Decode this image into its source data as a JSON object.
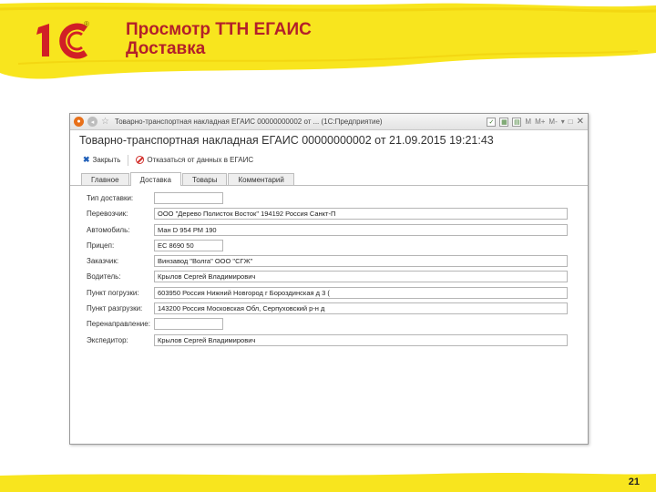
{
  "slide": {
    "logo_text": "1С",
    "logo_mark": "®",
    "title_line1": "Просмотр ТТН ЕГАИС",
    "title_line2": "Доставка",
    "page_number": "21",
    "accent_color": "#f8e51e",
    "title_color": "#b3202a"
  },
  "window": {
    "title": "Товарно-транспортная накладная ЕГАИС 00000000002 от ... (1С:Предприятие)",
    "controls": {
      "m": "M",
      "m_plus": "M+",
      "m_minus": "M-",
      "menu": "▾",
      "restore": "□",
      "close": "✕"
    },
    "doc_title": "Товарно-транспортная накладная ЕГАИС 00000000002 от 21.09.2015 19:21:43",
    "toolbar": {
      "close_label": "Закрыть",
      "reject_label": "Отказаться от данных в ЕГАИС"
    },
    "tabs": [
      {
        "label": "Главное",
        "active": false
      },
      {
        "label": "Доставка",
        "active": true
      },
      {
        "label": "Товары",
        "active": false
      },
      {
        "label": "Комментарий",
        "active": false
      }
    ],
    "fields": [
      {
        "label": "Тип доставки:",
        "value": "",
        "width": "short"
      },
      {
        "label": "Перевозчик:",
        "value": "ООО \"Дерево Полисток Восток\" 194192 Россия Санкт-П",
        "width": "long"
      },
      {
        "label": "Автомобиль:",
        "value": "Ман D 954 РМ 190",
        "width": "long"
      },
      {
        "label": "Прицеп:",
        "value": "ЕС 8690 50",
        "width": "short"
      },
      {
        "label": "Заказчик:",
        "value": "Винзавод \"Волга\" ООО \"СГЖ\"",
        "width": "long"
      },
      {
        "label": "Водитель:",
        "value": "Крылов Сергей Владимирович",
        "width": "long"
      },
      {
        "label": "Пункт погрузки:",
        "value": "603950 Россия Нижний Новгород г Бороздинская д 3 (",
        "width": "long"
      },
      {
        "label": "Пункт разгрузки:",
        "value": "143200 Россия Московская Обл, Серпуховский р-н д",
        "width": "long"
      },
      {
        "label": "Перенаправление:",
        "value": "",
        "width": "short"
      },
      {
        "label": "Экспедитор:",
        "value": "Крылов Сергей Владимирович",
        "width": "long"
      }
    ]
  }
}
